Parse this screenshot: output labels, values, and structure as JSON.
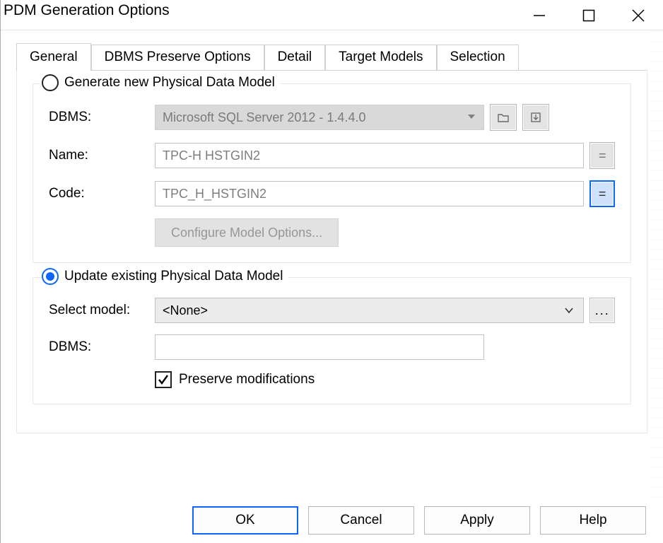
{
  "window": {
    "title": "PDM Generation Options"
  },
  "tabs": [
    {
      "label": "General"
    },
    {
      "label": "DBMS Preserve Options"
    },
    {
      "label": "Detail"
    },
    {
      "label": "Target Models"
    },
    {
      "label": "Selection"
    }
  ],
  "activeTabIndex": 0,
  "groupGenerate": {
    "legend": "Generate new Physical Data Model",
    "selected": false,
    "dbms_label": "DBMS:",
    "dbms_value": "Microsoft SQL Server 2012 - 1.4.4.0",
    "name_label": "Name:",
    "name_value": "TPC-H HSTGIN2",
    "code_label": "Code:",
    "code_value": "TPC_H_HSTGIN2",
    "configure_label": "Configure Model Options..."
  },
  "groupUpdate": {
    "legend": "Update existing Physical Data Model",
    "selected": true,
    "selectmodel_label": "Select model:",
    "selectmodel_value": "<None>",
    "dbms_label": "DBMS:",
    "dbms_value": "",
    "preserve_label": "Preserve modifications",
    "preserve_checked": true
  },
  "buttons": {
    "ok": "OK",
    "cancel": "Cancel",
    "apply": "Apply",
    "help": "Help"
  },
  "icons": {
    "equals": "=",
    "ellipsis": "..."
  }
}
